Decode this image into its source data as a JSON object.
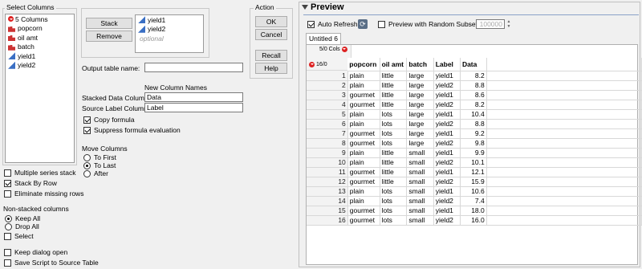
{
  "select_columns": {
    "title": "Select Columns",
    "count_label": "5 Columns",
    "items": [
      {
        "label": "popcorn",
        "kind": "nominal"
      },
      {
        "label": "oil amt",
        "kind": "nominal"
      },
      {
        "label": "batch",
        "kind": "nominal"
      },
      {
        "label": "yield1",
        "kind": "continuous"
      },
      {
        "label": "yield2",
        "kind": "continuous"
      }
    ]
  },
  "stack": {
    "stack_columns_label": "Stack Columns",
    "remove_label": "Remove",
    "selected": [
      "yield1",
      "yield2"
    ],
    "optional_label": "optional"
  },
  "action": {
    "title": "Action",
    "ok": "OK",
    "cancel": "Cancel",
    "recall": "Recall",
    "help": "Help"
  },
  "output": {
    "output_table_label": "Output table name:",
    "output_table_value": "",
    "new_column_names": "New Column Names",
    "stacked_data_label": "Stacked Data Column",
    "stacked_data_value": "Data",
    "source_label_label": "Source Label Column",
    "source_label_value": "Label",
    "copy_formula": "Copy formula",
    "suppress_formula": "Suppress formula evaluation"
  },
  "move_columns": {
    "title": "Move Columns",
    "options": [
      "To First",
      "To Last",
      "After"
    ],
    "selected": "To Last"
  },
  "options": {
    "multiple_series": "Multiple series stack",
    "stack_by_row": "Stack By Row",
    "eliminate_missing": "Eliminate missing rows"
  },
  "non_stacked": {
    "title": "Non-stacked columns",
    "keep_all": "Keep All",
    "drop_all": "Drop All",
    "select": "Select"
  },
  "footer": {
    "keep_dialog_open": "Keep dialog open",
    "save_script": "Save Script to Source Table"
  },
  "preview": {
    "title": "Preview",
    "auto_refresh": "Auto Refresh",
    "random_subset": "Preview with Random Subset",
    "subset_value": "100000",
    "tab": "Untitled 6",
    "cols_badge": "5/0 Cols",
    "rows_badge": "16/0",
    "columns": [
      "popcorn",
      "oil amt",
      "batch",
      "Label",
      "Data"
    ],
    "rows": [
      [
        "1",
        "plain",
        "little",
        "large",
        "yield1",
        "8.2"
      ],
      [
        "2",
        "plain",
        "little",
        "large",
        "yield2",
        "8.8"
      ],
      [
        "3",
        "gourmet",
        "little",
        "large",
        "yield1",
        "8.6"
      ],
      [
        "4",
        "gourmet",
        "little",
        "large",
        "yield2",
        "8.2"
      ],
      [
        "5",
        "plain",
        "lots",
        "large",
        "yield1",
        "10.4"
      ],
      [
        "6",
        "plain",
        "lots",
        "large",
        "yield2",
        "8.8"
      ],
      [
        "7",
        "gourmet",
        "lots",
        "large",
        "yield1",
        "9.2"
      ],
      [
        "8",
        "gourmet",
        "lots",
        "large",
        "yield2",
        "9.8"
      ],
      [
        "9",
        "plain",
        "little",
        "small",
        "yield1",
        "9.9"
      ],
      [
        "10",
        "plain",
        "little",
        "small",
        "yield2",
        "10.1"
      ],
      [
        "11",
        "gourmet",
        "little",
        "small",
        "yield1",
        "12.1"
      ],
      [
        "12",
        "gourmet",
        "little",
        "small",
        "yield2",
        "15.9"
      ],
      [
        "13",
        "plain",
        "lots",
        "small",
        "yield1",
        "10.6"
      ],
      [
        "14",
        "plain",
        "lots",
        "small",
        "yield2",
        "7.4"
      ],
      [
        "15",
        "gourmet",
        "lots",
        "small",
        "yield1",
        "18.0"
      ],
      [
        "16",
        "gourmet",
        "lots",
        "small",
        "yield2",
        "16.0"
      ]
    ]
  }
}
